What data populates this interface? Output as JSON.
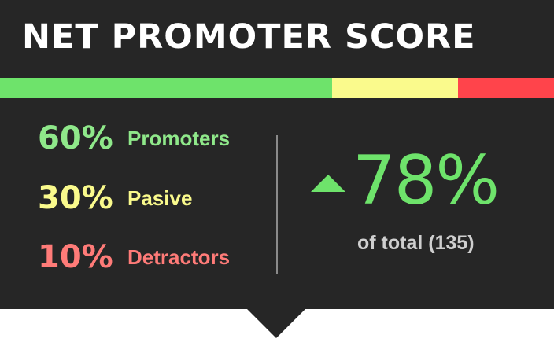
{
  "title": "NET PROMOTER SCORE",
  "distribution": [
    {
      "name": "promoters",
      "fraction": 0.6,
      "color": "#6ee36b"
    },
    {
      "name": "passive",
      "fraction": 0.2273,
      "color": "#fafa8c"
    },
    {
      "name": "detractors",
      "fraction": 0.1727,
      "color": "#ff444b"
    }
  ],
  "rows": [
    {
      "percent": "60%",
      "label": "Promoters",
      "color": "#8fe88a"
    },
    {
      "percent": "30%",
      "label": "Pasive",
      "color": "#fafa8c"
    },
    {
      "percent": "10%",
      "label": "Detractors",
      "color": "#ff7b78"
    }
  ],
  "score": {
    "value": "78%",
    "trend": "up",
    "caption": "of total (135)",
    "color": "#6ee36b"
  }
}
